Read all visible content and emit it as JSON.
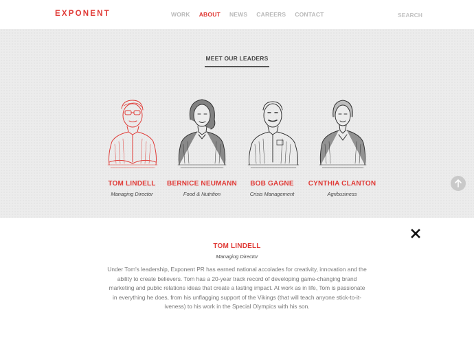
{
  "brand": {
    "logo_text": "EXPONENT",
    "accent_color": "#e03a36"
  },
  "nav": {
    "items": [
      {
        "label": "WORK",
        "active": false
      },
      {
        "label": "ABOUT",
        "active": true
      },
      {
        "label": "NEWS",
        "active": false
      },
      {
        "label": "CAREERS",
        "active": false
      },
      {
        "label": "CONTACT",
        "active": false
      }
    ],
    "search_label": "SEARCH"
  },
  "leaders_section": {
    "title": "MEET OUR LEADERS",
    "leaders": [
      {
        "name": "TOM LINDELL",
        "role": "Managing Director",
        "selected": true
      },
      {
        "name": "BERNICE NEUMANN",
        "role": "Food & Nutrition",
        "selected": false
      },
      {
        "name": "BOB GAGNE",
        "role": "Crisis Management",
        "selected": false
      },
      {
        "name": "CYNTHIA CLANTON",
        "role": "Agribusiness",
        "selected": false
      }
    ]
  },
  "detail": {
    "name": "TOM LINDELL",
    "role": "Managing Director",
    "bio": "Under Tom's leadership, Exponent PR has earned national accolades for creativity, innovation and the ability to create believers. Tom has a 20-year track record of developing game-changing brand marketing and public relations ideas that create a lasting impact. At work as in life, Tom is passionate in everything he does, from his unflagging support of the Vikings (that will teach anyone stick-to-it-iveness) to his work in the Special Olympics with his son."
  },
  "icons": {
    "close": "close-icon",
    "scroll_top": "arrow-up-icon"
  }
}
